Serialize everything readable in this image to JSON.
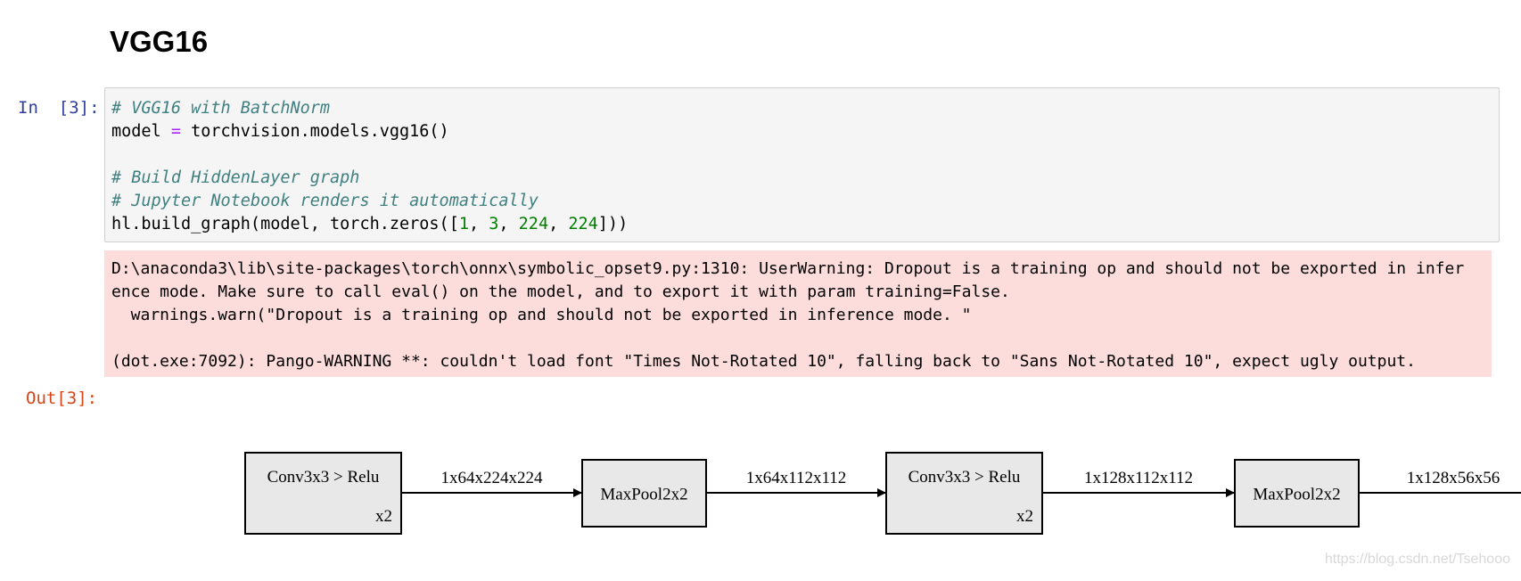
{
  "heading": "VGG16",
  "cell": {
    "in_prompt": "In  [3]:",
    "out_prompt": "Out[3]:",
    "code": {
      "line1_comment": "# VGG16 with BatchNorm",
      "line2_a": "model ",
      "line2_eq": "=",
      "line2_b": " torchvision.models.vgg16()",
      "line4_comment": "# Build HiddenLayer graph",
      "line5_comment": "# Jupyter Notebook renders it automatically",
      "line6_a": "hl.build_graph(model, torch.zeros([",
      "line6_n1": "1",
      "line6_s1": ", ",
      "line6_n2": "3",
      "line6_s2": ", ",
      "line6_n3": "224",
      "line6_s3": ", ",
      "line6_n4": "224",
      "line6_end": "]))"
    },
    "stderr": [
      "D:\\anaconda3\\lib\\site-packages\\torch\\onnx\\symbolic_opset9.py:1310: UserWarning: Dropout is a training op and should not be exported in infer",
      "ence mode. Make sure to call eval() on the model, and to export it with param training=False.",
      "  warnings.warn(\"Dropout is a training op and should not be exported in inference mode. \"",
      "",
      "(dot.exe:7092): Pango-WARNING **: couldn't load font \"Times Not-Rotated 10\", falling back to \"Sans Not-Rotated 10\", expect ugly output."
    ]
  },
  "graph": {
    "nodes": [
      {
        "label": "Conv3x3 > Relu",
        "repeat": "x2"
      },
      {
        "label": "MaxPool2x2"
      },
      {
        "label": "Conv3x3 > Relu",
        "repeat": "x2"
      },
      {
        "label": "MaxPool2x2"
      }
    ],
    "edges": [
      {
        "label": "1x64x224x224"
      },
      {
        "label": "1x64x112x112"
      },
      {
        "label": "1x128x112x112"
      },
      {
        "label": "1x128x56x56"
      }
    ],
    "colors": {
      "node_fill": "#e8e8e8",
      "stroke": "#000000"
    }
  },
  "watermark": "https://blog.csdn.net/Tsehooo"
}
